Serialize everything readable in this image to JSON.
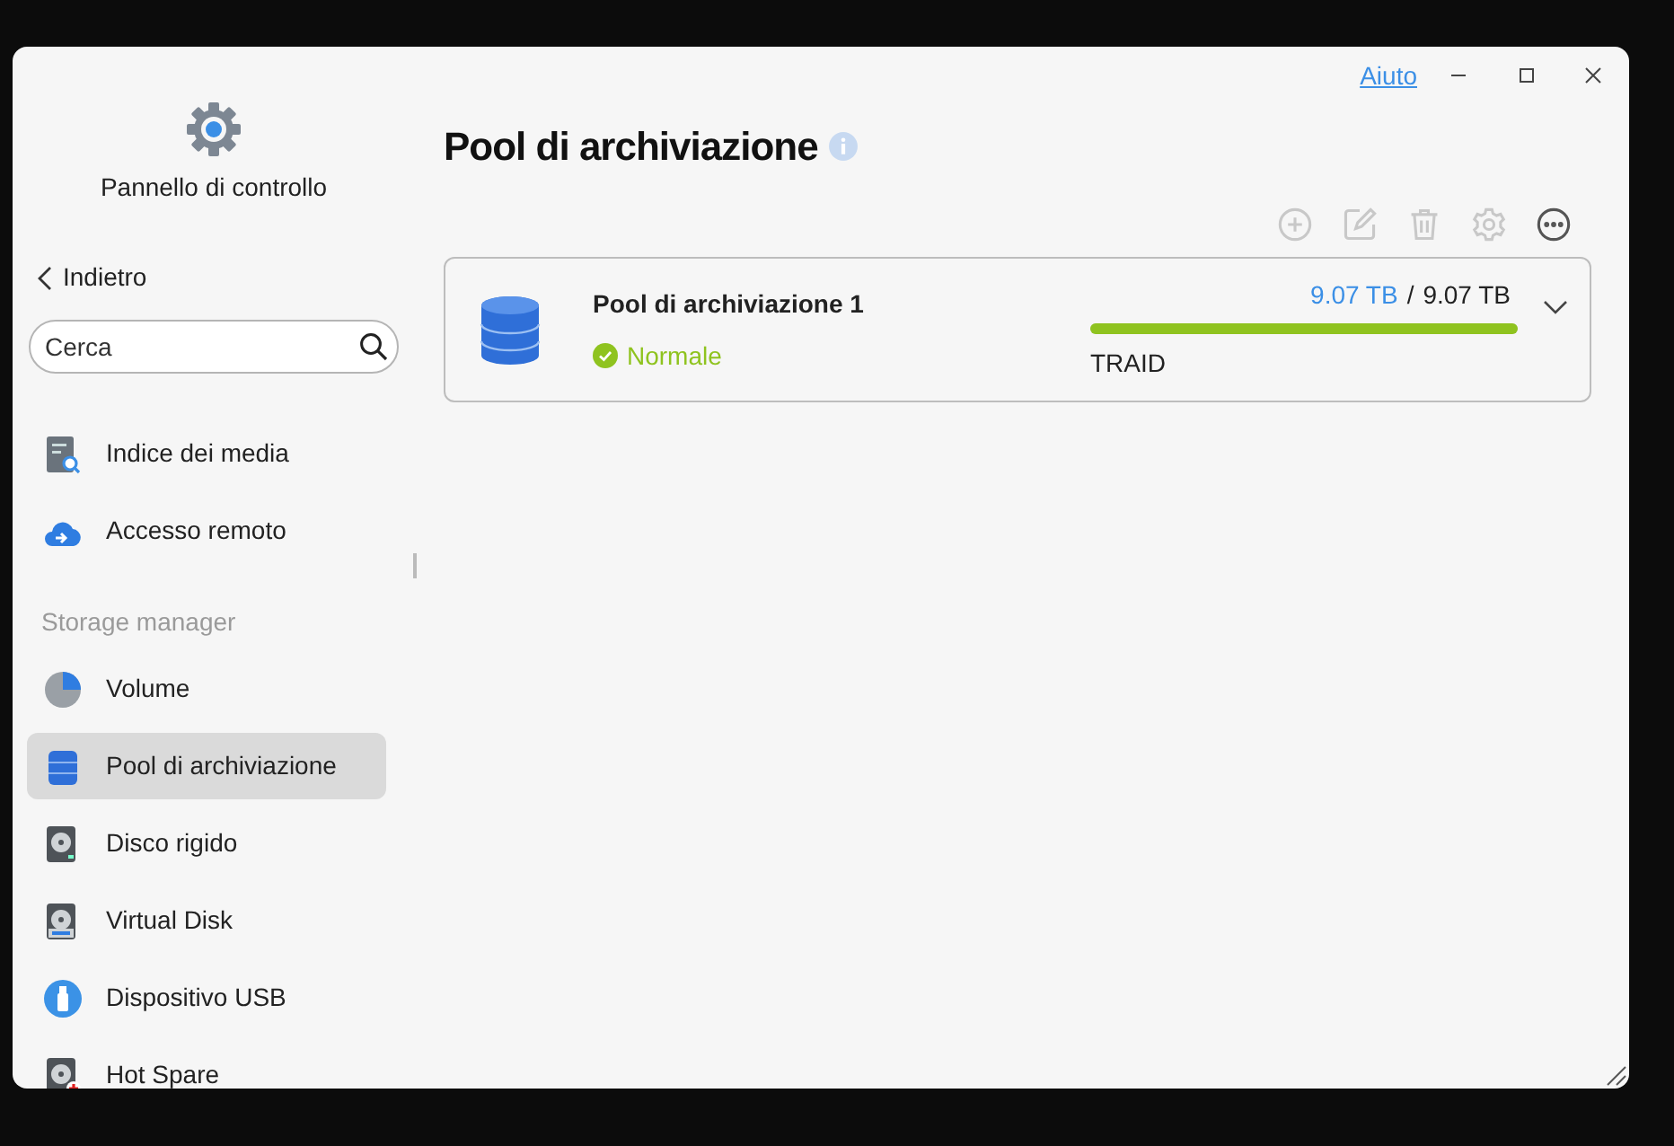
{
  "window": {
    "help_link": "Aiuto"
  },
  "sidebar": {
    "app_title": "Pannello di controllo",
    "back": "Indietro",
    "search": {
      "placeholder": "Cerca"
    },
    "groups": [
      {
        "items": [
          {
            "label": "Indice dei media",
            "kind": "media-index",
            "selected": false
          },
          {
            "label": "Accesso remoto",
            "kind": "remote",
            "selected": false
          }
        ]
      },
      {
        "header": "Storage manager",
        "items": [
          {
            "label": "Volume",
            "kind": "volume",
            "selected": false
          },
          {
            "label": "Pool di archiviazione",
            "kind": "pool",
            "selected": true
          },
          {
            "label": "Disco rigido",
            "kind": "disk",
            "selected": false
          },
          {
            "label": "Virtual Disk",
            "kind": "vdisk",
            "selected": false
          },
          {
            "label": "Dispositivo USB",
            "kind": "usb",
            "selected": false
          },
          {
            "label": "Hot Spare",
            "kind": "spare",
            "selected": false
          }
        ]
      }
    ]
  },
  "main": {
    "title": "Pool di archiviazione",
    "toolbar": [
      {
        "kind": "add",
        "disabled": true
      },
      {
        "kind": "edit",
        "disabled": true
      },
      {
        "kind": "delete",
        "disabled": true
      },
      {
        "kind": "settings",
        "disabled": true
      },
      {
        "kind": "more",
        "disabled": false
      }
    ],
    "pools": [
      {
        "name": "Pool di archiviazione 1",
        "status": "Normale",
        "used": "9.07 TB",
        "separator": "/",
        "total": "9.07 TB",
        "level": 1,
        "raid": "TRAID",
        "expanded": false
      }
    ]
  }
}
